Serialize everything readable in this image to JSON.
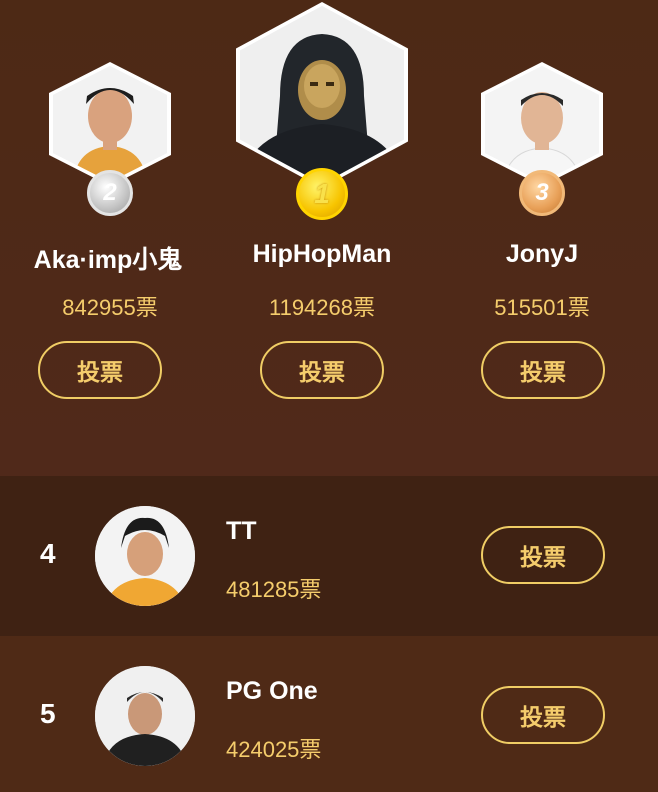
{
  "vote_button_label": "投票",
  "podium": [
    {
      "rank": "2",
      "name": "Aka·imp小鬼",
      "votes": "842955票",
      "medal": "silver-medal"
    },
    {
      "rank": "1",
      "name": "HipHopMan",
      "votes": "1194268票",
      "medal": "gold-medal"
    },
    {
      "rank": "3",
      "name": "JonyJ",
      "votes": "515501票",
      "medal": "bronze-medal"
    }
  ],
  "ranking": [
    {
      "rank": "4",
      "name": "TT",
      "votes": "481285票"
    },
    {
      "rank": "5",
      "name": "PG One",
      "votes": "424025票"
    }
  ],
  "colors": {
    "background": "#4f2a16",
    "row_alt": "#3f2213",
    "accent": "#f5cd6c",
    "gold": "#f7c400",
    "silver": "#c4c4c4",
    "bronze": "#e8a058"
  }
}
